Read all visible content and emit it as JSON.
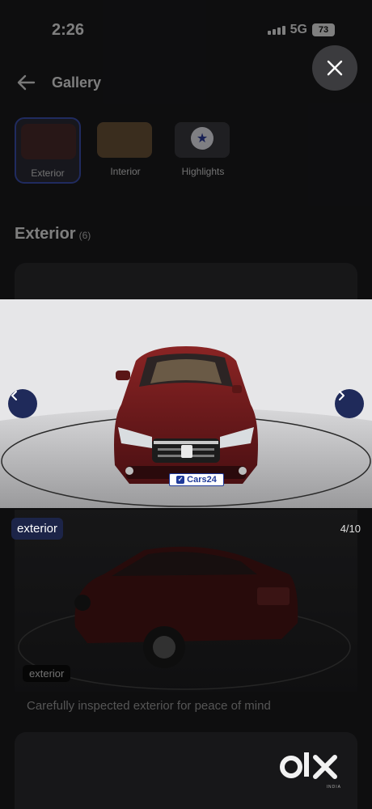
{
  "status_bar": {
    "time": "2:26",
    "network": "5G",
    "battery": "73"
  },
  "header": {
    "title": "Gallery"
  },
  "tabs": [
    {
      "label": "Exterior",
      "active": true
    },
    {
      "label": "Interior",
      "active": false
    },
    {
      "label": "Highlights",
      "active": false
    }
  ],
  "section": {
    "title": "Exterior",
    "count": "(6)"
  },
  "viewer": {
    "tag": "exterior",
    "counter": "4/10",
    "plate_text": "Cars24",
    "car_color": "#7a1e1e"
  },
  "card": {
    "tag": "exterior",
    "caption": "Carefully inspected exterior for peace of mind"
  },
  "branding": {
    "logo": "OLX",
    "logo_sub": "INDIA"
  },
  "colors": {
    "accent": "#1f2a5a",
    "tab_border": "#3b4fae"
  }
}
